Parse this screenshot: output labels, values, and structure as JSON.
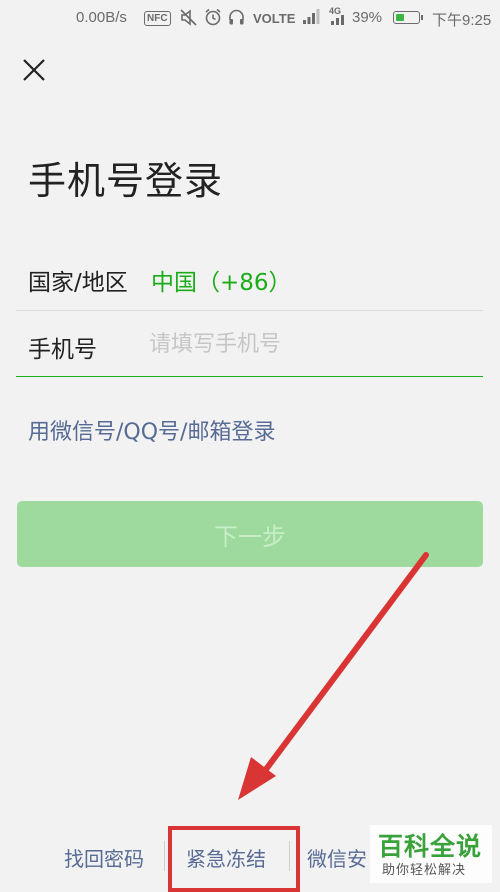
{
  "status_bar": {
    "speed": "0.00B/s",
    "nfc": "NFC",
    "volte": "VOLTE",
    "network": "4G",
    "battery": "39%",
    "battery_level": 0.39,
    "time": "下午9:25"
  },
  "title": "手机号登录",
  "region": {
    "label": "国家/地区",
    "value": "中国（+86）"
  },
  "phone": {
    "label": "手机号",
    "placeholder": "请填写手机号",
    "value": ""
  },
  "alt_login": "用微信号/QQ号/邮箱登录",
  "next_button": "下一步",
  "footer": {
    "recover_password": "找回密码",
    "emergency_freeze": "紧急冻结",
    "security_center": "微信安"
  },
  "watermark": {
    "main": "百科全说",
    "sub": "助你轻松解决"
  },
  "colors": {
    "accent_green": "#1aad19",
    "link_blue": "#576b95",
    "button_disabled": "#9ed99d",
    "annotation_red": "#d93535"
  }
}
